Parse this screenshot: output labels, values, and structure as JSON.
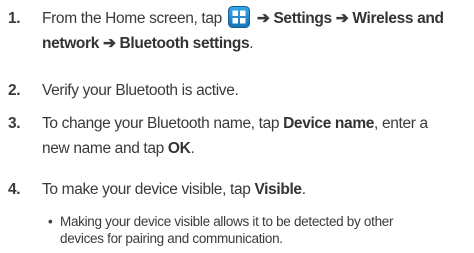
{
  "steps": [
    {
      "number": "1.",
      "line1_prefix": "From the Home screen, tap ",
      "line1_arrow1": " ➔ ",
      "line1_settings": "Settings",
      "line1_arrow2": " ➔ ",
      "line1_wireless": "Wireless and",
      "line2_network": "network",
      "line2_arrow": " ➔ ",
      "line2_bluetooth": "Bluetooth settings",
      "line2_suffix": ".",
      "icon": "apps-grid-icon"
    },
    {
      "number": "2.",
      "text": "Verify your Bluetooth is active."
    },
    {
      "number": "3.",
      "line1_prefix": "To change your Bluetooth name, tap ",
      "line1_bold": "Device name",
      "line1_suffix": ", enter a",
      "line2_prefix": "new name and tap ",
      "line2_bold": "OK",
      "line2_suffix": "."
    },
    {
      "number": "4.",
      "prefix": "To make your device visible, tap ",
      "bold": "Visible",
      "suffix": "."
    }
  ],
  "bullet": {
    "dot": "•",
    "line1": "Making your device visible allows it to be detected by other",
    "line2": "devices for pairing and communication."
  },
  "colors": {
    "icon_blue": "#1f8fd6",
    "icon_blue_dark": "#1673b3",
    "text": "#3a3a3a"
  }
}
